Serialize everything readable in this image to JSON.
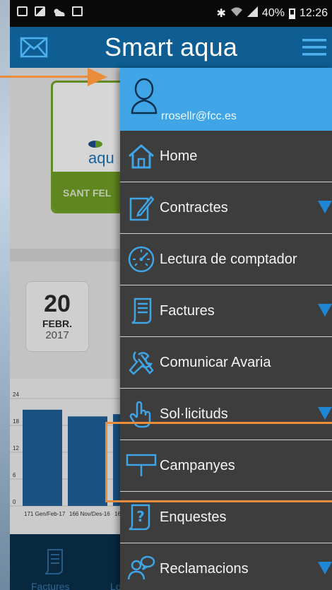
{
  "status_bar": {
    "battery": "40%",
    "time": "12:26"
  },
  "app_bar": {
    "title": "Smart aqua",
    "left_icon": "mail-icon",
    "right_icon": "hamburger-menu-icon"
  },
  "background": {
    "card_label": "SANT FEL",
    "card_logo": "aqu",
    "date": {
      "day": "20",
      "month": "FEBR.",
      "year": "2017"
    },
    "tab_bar": {
      "tab1_label": "Factures",
      "tab2_label": "Lo"
    }
  },
  "chart_data": {
    "type": "bar",
    "categories": [
      "171 Gen/Feb-17",
      "166 Nov/Des-16",
      "16"
    ],
    "values": [
      21.5,
      20,
      20.5
    ],
    "title": "",
    "xlabel": "",
    "ylabel": "",
    "ylim": [
      0,
      24
    ],
    "yticks": [
      0,
      6,
      12,
      18,
      24
    ],
    "grid": true,
    "colors": [
      "#1f5f96"
    ]
  },
  "drawer": {
    "user_email": "rrosellr@fcc.es",
    "header_color": "#3fa5e6",
    "items": [
      {
        "label": "Home",
        "icon": "home-icon",
        "has_submenu": false
      },
      {
        "label": "Contractes",
        "icon": "pencil-document-icon",
        "has_submenu": true
      },
      {
        "label": "Lectura de comptador",
        "icon": "gauge-icon",
        "has_submenu": false
      },
      {
        "label": "Factures",
        "icon": "invoice-icon",
        "has_submenu": true
      },
      {
        "label": "Comunicar Avaria",
        "icon": "wrench-icon",
        "has_submenu": false
      },
      {
        "label": "Sol·licituds",
        "icon": "pointing-hand-icon",
        "has_submenu": true
      },
      {
        "label": "Campanyes",
        "icon": "signboard-icon",
        "has_submenu": false
      },
      {
        "label": "Enquestes",
        "icon": "question-document-icon",
        "has_submenu": false
      },
      {
        "label": "Reclamacions",
        "icon": "chat-people-icon",
        "has_submenu": true
      }
    ]
  },
  "annotation": {
    "color": "#e98d3b",
    "highlighted_item": "Campanyes"
  }
}
